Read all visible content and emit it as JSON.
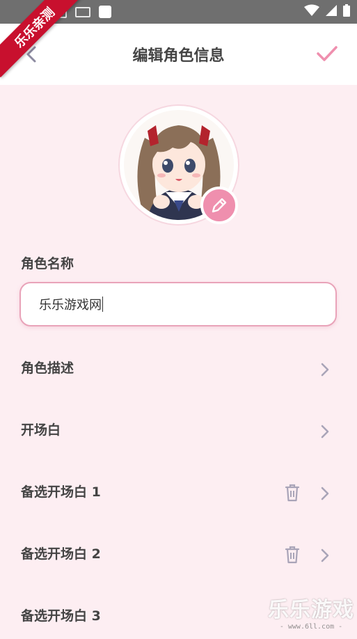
{
  "ribbon": {
    "text": "乐乐亲测"
  },
  "status_bar": {
    "icons": [
      "photo-icon",
      "keyboard-icon",
      "notification-icon",
      "wifi-icon",
      "signal-icon",
      "battery-icon"
    ]
  },
  "header": {
    "title": "编辑角色信息",
    "back_icon": "chevron-left-icon",
    "confirm_icon": "check-icon"
  },
  "avatar": {
    "edit_icon": "pencil-icon"
  },
  "form": {
    "name_label": "角色名称",
    "name_value": "乐乐游戏网"
  },
  "rows": [
    {
      "label": "角色描述",
      "has_delete": false
    },
    {
      "label": "开场白",
      "has_delete": false
    },
    {
      "label": "备选开场白 1",
      "has_delete": true
    },
    {
      "label": "备选开场白 2",
      "has_delete": true
    },
    {
      "label": "备选开场白 3",
      "has_delete": false
    }
  ],
  "watermark": {
    "text": "乐乐游戏",
    "url": "- www.6ll.com -"
  },
  "colors": {
    "accent": "#ef8fae",
    "background": "#fdeef2",
    "text": "#444444",
    "icon_gray": "#a9a4b8"
  }
}
